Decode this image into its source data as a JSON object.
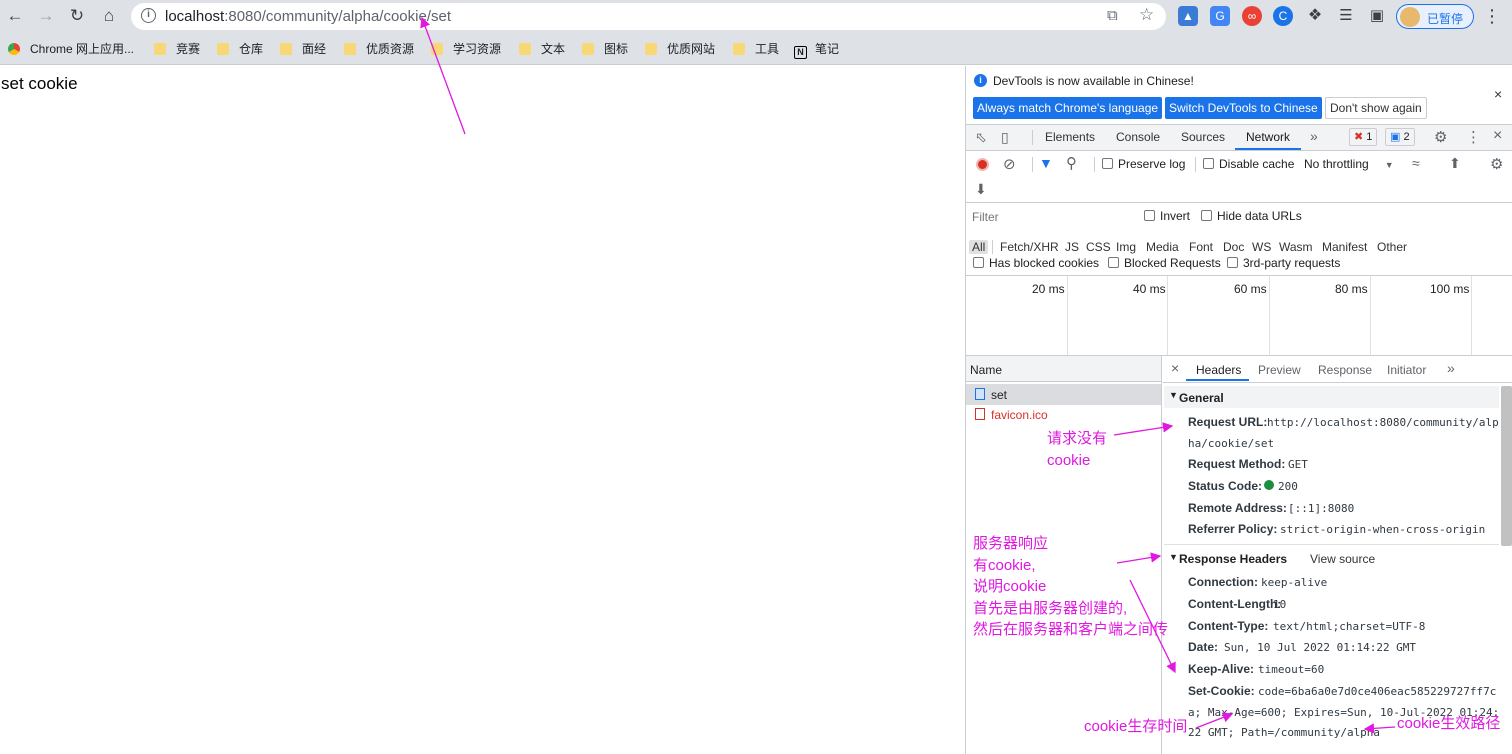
{
  "browser": {
    "url_host": "localhost",
    "url_path": ":8080/community/alpha/cookie/set",
    "profile_label": "已暂停",
    "bookmarks": [
      "Chrome 网上应用...",
      "竞赛",
      "仓库",
      "面经",
      "优质资源",
      "学习资源",
      "文本",
      "图标",
      "优质网站",
      "工具",
      "笔记"
    ]
  },
  "page": {
    "text": "set cookie"
  },
  "devtools": {
    "infobar_text": "DevTools is now available in Chinese!",
    "btn_match": "Always match Chrome's language",
    "btn_switch": "Switch DevTools to Chinese",
    "btn_dont_show": "Don't show again",
    "tabs": [
      "Elements",
      "Console",
      "Sources",
      "Network"
    ],
    "error_count": "1",
    "message_count": "2",
    "preserve_log": "Preserve log",
    "disable_cache": "Disable cache",
    "throttling": "No throttling",
    "filter_placeholder": "Filter",
    "invert": "Invert",
    "hide_data_urls": "Hide data URLs",
    "filter_types": [
      "All",
      "Fetch/XHR",
      "JS",
      "CSS",
      "Img",
      "Media",
      "Font",
      "Doc",
      "WS",
      "Wasm",
      "Manifest",
      "Other"
    ],
    "has_blocked_cookies": "Has blocked cookies",
    "blocked_requests": "Blocked Requests",
    "third_party": "3rd-party requests",
    "timeline_ticks": [
      "20 ms",
      "40 ms",
      "60 ms",
      "80 ms",
      "100 ms"
    ],
    "name_header": "Name",
    "requests": [
      "set",
      "favicon.ico"
    ],
    "detail_tabs": [
      "Headers",
      "Preview",
      "Response",
      "Initiator"
    ],
    "general_title": "General",
    "general": {
      "request_url_key": "Request URL:",
      "request_url_val_1": "http://localhost:8080/community/alp",
      "request_url_val_2": "ha/cookie/set",
      "method_key": "Request Method:",
      "method_val": "GET",
      "status_key": "Status Code:",
      "status_val": "200",
      "remote_key": "Remote Address:",
      "remote_val": "[::1]:8080",
      "referrer_key": "Referrer Policy:",
      "referrer_val": "strict-origin-when-cross-origin"
    },
    "response_title": "Response Headers",
    "view_source": "View source",
    "response": {
      "connection_key": "Connection:",
      "connection_val": "keep-alive",
      "length_key": "Content-Length:",
      "length_val": "10",
      "type_key": "Content-Type:",
      "type_val": "text/html;charset=UTF-8",
      "date_key": "Date:",
      "date_val": "Sun, 10 Jul 2022 01:14:22 GMT",
      "keepalive_key": "Keep-Alive:",
      "keepalive_val": "timeout=60",
      "setcookie_key": "Set-Cookie:",
      "setcookie_val_1": "code=6ba6a0e7d0ce406eac585229727ff7c",
      "setcookie_val_2": "a; Max-Age=600; Expires=Sun, 10-Jul-2022 01:24:",
      "setcookie_val_3": "22 GMT; Path=/community/alpha"
    }
  },
  "annotations": {
    "request_no_cookie_1": "请求没有",
    "request_no_cookie_2": "cookie",
    "server_1": "服务器响应",
    "server_2": "有cookie,",
    "server_3": "说明cookie",
    "server_4": "首先是由服务器创建的,",
    "server_5": "然后在服务器和客户端之间传",
    "lifetime": "cookie生存时间",
    "path": "cookie生效路径",
    "colors": {
      "annotation": "#e018e0",
      "chrome_blue": "#1a73e8",
      "network_tab_underline": "#1a73e8"
    }
  }
}
